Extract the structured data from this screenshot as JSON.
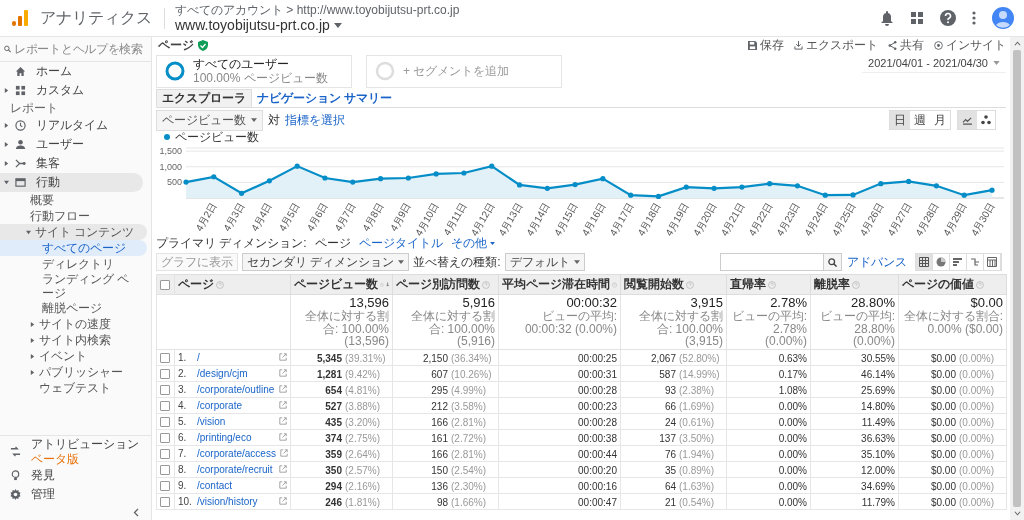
{
  "app": {
    "name": "アナリティクス",
    "breadcrumb": "すべてのアカウント > http://www.toyobijutsu-prt.co.jp",
    "property": "www.toyobijutsu-prt.co.jp"
  },
  "sidebar": {
    "search": {
      "placeholder": "レポートとヘルプを検索"
    },
    "items": [
      {
        "kind": "item",
        "label": "ホーム",
        "selected": false
      },
      {
        "kind": "item",
        "label": "カスタム",
        "expanded": false,
        "selected": false
      },
      {
        "kind": "section",
        "label": "レポート"
      },
      {
        "kind": "item",
        "label": "リアルタイム",
        "expanded": false,
        "selected": false
      },
      {
        "kind": "item",
        "label": "ユーザー",
        "expanded": false,
        "selected": false
      },
      {
        "kind": "item",
        "label": "集客",
        "expanded": false,
        "selected": false
      },
      {
        "kind": "item",
        "label": "行動",
        "expanded": true,
        "selected": true,
        "children": [
          {
            "label": "概要",
            "selected": false
          },
          {
            "label": "行動フロー",
            "selected": false
          },
          {
            "label": "サイト コンテンツ",
            "expanded": true,
            "selected": true,
            "children": [
              {
                "label": "すべてのページ",
                "selected": true
              },
              {
                "label": "ディレクトリ",
                "selected": false
              },
              {
                "label": "ランディング ページ",
                "selected": false
              },
              {
                "label": "離脱ページ",
                "selected": false
              }
            ]
          },
          {
            "label": "サイトの速度",
            "expanded": false,
            "selected": false
          },
          {
            "label": "サイト内検索",
            "expanded": false,
            "selected": false
          },
          {
            "label": "イベント",
            "expanded": false,
            "selected": false
          },
          {
            "label": "パブリッシャー",
            "expanded": false,
            "selected": false
          },
          {
            "label": "ウェブテスト",
            "selected": false
          }
        ]
      }
    ],
    "footer_items": [
      {
        "label": "アトリビューション",
        "badge": "ベータ版",
        "selected": false
      },
      {
        "label": "発見",
        "selected": false
      },
      {
        "label": "管理",
        "selected": false
      }
    ]
  },
  "report": {
    "title": "ページ",
    "actions": [
      "保存",
      "エクスポート",
      "共有",
      "インサイト"
    ],
    "segments": [
      {
        "kind": "segment",
        "name": "すべてのユーザー",
        "detail": "100.00% ページビュー数"
      },
      {
        "kind": "add",
        "name": "+ セグメントを追加"
      }
    ],
    "date_range": "2021/04/01 - 2021/04/30",
    "tabs": [
      {
        "label": "エクスプローラ",
        "selected": true
      },
      {
        "label": "ナビゲーション サマリー",
        "selected": false
      }
    ],
    "metric": {
      "value": "ページビュー数",
      "versus": "対",
      "select_link": "指標を選択"
    },
    "periods": [
      {
        "label": "日",
        "selected": true
      },
      {
        "label": "週",
        "selected": false
      },
      {
        "label": "月",
        "selected": false
      }
    ],
    "chart_types": [
      {
        "selected": true
      },
      {
        "selected": false
      }
    ],
    "chart": {
      "chart_data": {
        "type": "area",
        "categories": [
          null,
          "4月2日",
          "4月3日",
          "4月4日",
          "4月5日",
          "4月6日",
          "4月7日",
          "4月8日",
          "4月9日",
          "4月10日",
          "4月11日",
          "4月12日",
          "4月13日",
          "4月14日",
          "4月15日",
          "4月16日",
          "4月17日",
          "4月18日",
          "4月19日",
          "4月20日",
          "4月21日",
          "4月22日",
          "4月23日",
          "4月24日",
          "4月25日",
          "4月26日",
          "4月27日",
          "4月28日",
          "4月29日",
          "4月30日"
        ],
        "series": [
          {
            "name": "ページビュー数",
            "color": "#058dc7",
            "values": [
              510,
              680,
              150,
              550,
              1020,
              640,
              510,
              620,
              640,
              770,
              800,
              1020,
              420,
              310,
              430,
              620,
              90,
              50,
              350,
              310,
              350,
              460,
              390,
              90,
              100,
              460,
              530,
              390,
              90,
              250
            ]
          }
        ],
        "ylim": [
          0,
          1600
        ],
        "grid": true,
        "yticks": [
          {
            "value": 500,
            "label": "500"
          },
          {
            "value": 1000,
            "label": "1,000"
          },
          {
            "value": 1500,
            "label": "1,500"
          }
        ]
      }
    },
    "primary_dimension": {
      "label": "プライマリ ディメンション:",
      "options": [
        {
          "label": "ページ",
          "selected": true
        },
        {
          "label": "ページタイトル",
          "selected": false
        },
        {
          "label": "その他",
          "selected": false
        }
      ]
    },
    "toolbar": {
      "plot_button": {
        "label": "グラフに表示",
        "disabled": true
      },
      "secondary": "セカンダリ ディメンション",
      "sort_label": "並べ替えの種類:",
      "sort": "デフォルト",
      "advanced": "アドバンス",
      "views": [
        {
          "selected": true
        },
        {
          "selected": false
        },
        {
          "selected": false
        },
        {
          "selected": false
        },
        {
          "selected": false
        }
      ]
    },
    "table": {
      "select_all": {
        "checked": false
      },
      "columns": [
        {
          "label": "ページ",
          "sorted": false
        },
        {
          "label": "ページビュー数",
          "sorted": true
        },
        {
          "label": "ページ別訪問数",
          "sorted": false
        },
        {
          "label": "平均ページ滞在時間",
          "sorted": false
        },
        {
          "label": "閲覧開始数",
          "sorted": false
        },
        {
          "label": "直帰率",
          "sorted": false
        },
        {
          "label": "離脱率",
          "sorted": false
        },
        {
          "label": "ページの価値",
          "sorted": false
        }
      ],
      "totals": [
        {
          "value": "13,596",
          "note": "全体に対する割合: 100.00% (13,596)"
        },
        {
          "value": "5,916",
          "note": "全体に対する割合: 100.00% (5,916)"
        },
        {
          "value": "00:00:32",
          "note": "ビューの平均: 00:00:32 (0.00%)"
        },
        {
          "value": "3,915",
          "note": "全体に対する割合: 100.00% (3,915)"
        },
        {
          "value": "2.78%",
          "note": "ビューの平均: 2.78% (0.00%)"
        },
        {
          "value": "28.80%",
          "note": "ビューの平均: 28.80% (0.00%)"
        },
        {
          "value": "$0.00",
          "note": "全体に対する割合: 0.00% ($0.00)"
        }
      ],
      "rows": [
        {
          "checked": false,
          "num": "1.",
          "page": "/",
          "pageviews": "5,345",
          "pageviews_share": "(39.31%)",
          "visits": "2,150",
          "visits_share": "(36.34%)",
          "avg_time": "00:00:25",
          "entrances": "2,067",
          "entrances_share": "(52.80%)",
          "bounce_rate": "0.63%",
          "exit_rate": "30.55%",
          "page_value": "$0.00",
          "page_value_share": "(0.00%)"
        },
        {
          "checked": false,
          "num": "2.",
          "page": "/design/cjm",
          "pageviews": "1,281",
          "pageviews_share": "(9.42%)",
          "visits": "607",
          "visits_share": "(10.26%)",
          "avg_time": "00:00:31",
          "entrances": "587",
          "entrances_share": "(14.99%)",
          "bounce_rate": "0.17%",
          "exit_rate": "46.14%",
          "page_value": "$0.00",
          "page_value_share": "(0.00%)"
        },
        {
          "checked": false,
          "num": "3.",
          "page": "/corporate/outline",
          "pageviews": "654",
          "pageviews_share": "(4.81%)",
          "visits": "295",
          "visits_share": "(4.99%)",
          "avg_time": "00:00:28",
          "entrances": "93",
          "entrances_share": "(2.38%)",
          "bounce_rate": "1.08%",
          "exit_rate": "25.69%",
          "page_value": "$0.00",
          "page_value_share": "(0.00%)"
        },
        {
          "checked": false,
          "num": "4.",
          "page": "/corporate",
          "pageviews": "527",
          "pageviews_share": "(3.88%)",
          "visits": "212",
          "visits_share": "(3.58%)",
          "avg_time": "00:00:23",
          "entrances": "66",
          "entrances_share": "(1.69%)",
          "bounce_rate": "0.00%",
          "exit_rate": "14.80%",
          "page_value": "$0.00",
          "page_value_share": "(0.00%)"
        },
        {
          "checked": false,
          "num": "5.",
          "page": "/vision",
          "pageviews": "435",
          "pageviews_share": "(3.20%)",
          "visits": "166",
          "visits_share": "(2.81%)",
          "avg_time": "00:00:28",
          "entrances": "24",
          "entrances_share": "(0.61%)",
          "bounce_rate": "0.00%",
          "exit_rate": "11.49%",
          "page_value": "$0.00",
          "page_value_share": "(0.00%)"
        },
        {
          "checked": false,
          "num": "6.",
          "page": "/printing/eco",
          "pageviews": "374",
          "pageviews_share": "(2.75%)",
          "visits": "161",
          "visits_share": "(2.72%)",
          "avg_time": "00:00:38",
          "entrances": "137",
          "entrances_share": "(3.50%)",
          "bounce_rate": "0.00%",
          "exit_rate": "36.63%",
          "page_value": "$0.00",
          "page_value_share": "(0.00%)"
        },
        {
          "checked": false,
          "num": "7.",
          "page": "/corporate/access",
          "pageviews": "359",
          "pageviews_share": "(2.64%)",
          "visits": "166",
          "visits_share": "(2.81%)",
          "avg_time": "00:00:44",
          "entrances": "76",
          "entrances_share": "(1.94%)",
          "bounce_rate": "0.00%",
          "exit_rate": "35.10%",
          "page_value": "$0.00",
          "page_value_share": "(0.00%)"
        },
        {
          "checked": false,
          "num": "8.",
          "page": "/corporate/recruit",
          "pageviews": "350",
          "pageviews_share": "(2.57%)",
          "visits": "150",
          "visits_share": "(2.54%)",
          "avg_time": "00:00:20",
          "entrances": "35",
          "entrances_share": "(0.89%)",
          "bounce_rate": "0.00%",
          "exit_rate": "12.00%",
          "page_value": "$0.00",
          "page_value_share": "(0.00%)"
        },
        {
          "checked": false,
          "num": "9.",
          "page": "/contact",
          "pageviews": "294",
          "pageviews_share": "(2.16%)",
          "visits": "136",
          "visits_share": "(2.30%)",
          "avg_time": "00:00:16",
          "entrances": "64",
          "entrances_share": "(1.63%)",
          "bounce_rate": "0.00%",
          "exit_rate": "34.69%",
          "page_value": "$0.00",
          "page_value_share": "(0.00%)"
        },
        {
          "checked": false,
          "num": "10.",
          "page": "/vision/history",
          "pageviews": "246",
          "pageviews_share": "(1.81%)",
          "visits": "98",
          "visits_share": "(1.66%)",
          "avg_time": "00:00:47",
          "entrances": "21",
          "entrances_share": "(0.54%)",
          "bounce_rate": "0.00%",
          "exit_rate": "11.79%",
          "page_value": "$0.00",
          "page_value_share": "(0.00%)"
        }
      ]
    }
  }
}
